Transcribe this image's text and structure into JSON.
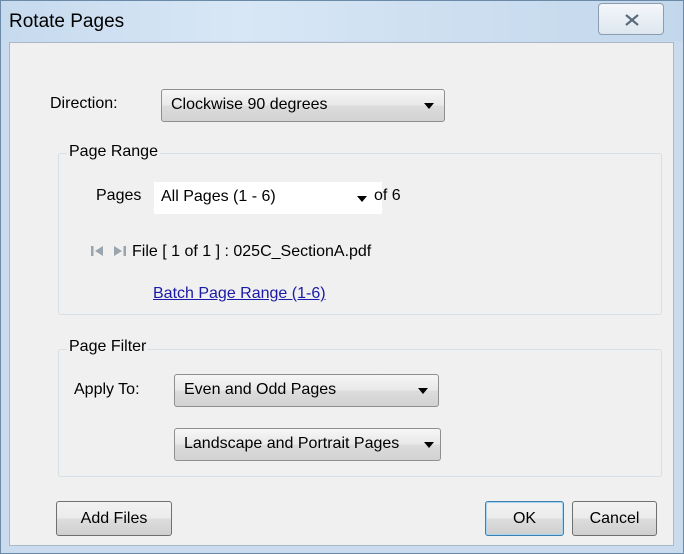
{
  "window": {
    "title": "Rotate Pages"
  },
  "direction": {
    "label": "Direction:",
    "value": "Clockwise 90 degrees"
  },
  "page_range": {
    "group_title": "Page Range",
    "pages_label": "Pages",
    "pages_value": "All Pages (1 - 6)",
    "of_text": "of 6",
    "file_text": "File [ 1 of 1 ] : 025C_SectionA.pdf",
    "batch_link": "Batch Page Range (1-6)"
  },
  "page_filter": {
    "group_title": "Page Filter",
    "apply_label": "Apply To:",
    "parity_value": "Even and Odd Pages",
    "orientation_value": "Landscape and Portrait Pages"
  },
  "buttons": {
    "add_files": "Add Files",
    "ok": "OK",
    "cancel": "Cancel"
  },
  "icons": {
    "close": "close-icon",
    "first": "first-page-icon",
    "last": "last-page-icon"
  }
}
